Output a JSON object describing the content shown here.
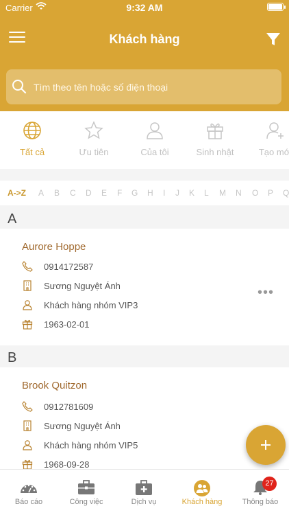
{
  "status_bar": {
    "carrier": "Carrier",
    "time": "9:32 AM"
  },
  "header": {
    "title": "Khách hàng"
  },
  "search": {
    "placeholder": "Tìm theo tên hoặc số điện thoại"
  },
  "filters": [
    {
      "label": "Tất cả",
      "icon": "globe-icon",
      "active": true
    },
    {
      "label": "Ưu tiên",
      "icon": "star-icon",
      "active": false
    },
    {
      "label": "Của tôi",
      "icon": "user-icon",
      "active": false
    },
    {
      "label": "Sinh nhật",
      "icon": "gift-icon",
      "active": false
    },
    {
      "label": "Tạo mới",
      "icon": "user-add-icon",
      "active": false
    }
  ],
  "alphabet": {
    "az": "A->Z",
    "letters": [
      "A",
      "B",
      "C",
      "D",
      "E",
      "F",
      "G",
      "H",
      "I",
      "J",
      "K",
      "L",
      "M",
      "N",
      "O",
      "P",
      "Q"
    ]
  },
  "sections": [
    {
      "letter": "A",
      "customer": {
        "name": "Aurore Hoppe",
        "phone": "0914172587",
        "company": "Sương Nguyệt Ánh",
        "group": "Khách hàng nhóm VIP3",
        "birthday": "1963-02-01"
      }
    },
    {
      "letter": "B",
      "customer": {
        "name": "Brook Quitzon",
        "phone": "0912781609",
        "company": "Sương Nguyệt Ánh",
        "group": "Khách hàng nhóm VIP5",
        "birthday": "1968-09-28"
      }
    }
  ],
  "more_label": "•••",
  "tabbar": [
    {
      "label": "Báo cáo",
      "icon": "dashboard-icon",
      "active": false
    },
    {
      "label": "Công việc",
      "icon": "briefcase-icon",
      "active": false
    },
    {
      "label": "Dịch vụ",
      "icon": "medical-kit-icon",
      "active": false
    },
    {
      "label": "Khách hàng",
      "icon": "customers-icon",
      "active": true
    },
    {
      "label": "Thông báo",
      "icon": "bell-icon",
      "active": false,
      "badge": "27"
    }
  ],
  "colors": {
    "accent": "#d9a534",
    "name": "#a0692e",
    "badge": "#e0241b"
  }
}
